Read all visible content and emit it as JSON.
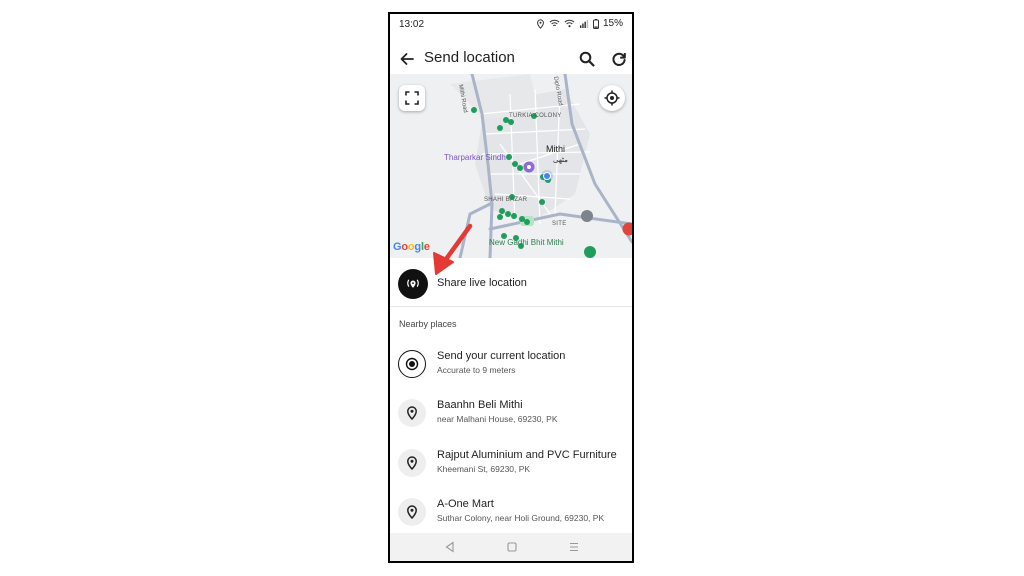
{
  "status_bar": {
    "time": "13:02",
    "battery": "15%",
    "icons": [
      "location-icon",
      "wifi-icon",
      "wifi-call-icon",
      "signal-icon",
      "battery-icon"
    ]
  },
  "app_bar": {
    "title": "Send location",
    "back_icon": "arrow-left-icon",
    "search_icon": "search-icon",
    "refresh_icon": "refresh-icon"
  },
  "map": {
    "labels": {
      "turkia": "TURKIA COLONY",
      "tharparkar": "Tharparkar Sindh",
      "mithi": "Mithi",
      "mithi_urdu": "مٹھی",
      "shahi_bazar": "SHAHI BAZAR",
      "site": "SITE",
      "gadhi": "New Gadhi Bhit Mithi",
      "road": "Mithi Road",
      "road2": "Diplo Road"
    },
    "logo": "Google",
    "buttons": [
      "fullscreen-icon",
      "my-location-icon"
    ]
  },
  "share_live": {
    "label": "Share live location",
    "icon": "live-location-icon"
  },
  "nearby": {
    "header": "Nearby places",
    "current": {
      "title": "Send your current location",
      "subtitle": "Accurate to 9 meters"
    },
    "places": [
      {
        "title": "Baanhn Beli Mithi",
        "subtitle": "near Malhani House, 69230, PK"
      },
      {
        "title": "Rajput Aluminium and PVC Furniture",
        "subtitle": "Kheemani St, 69230, PK"
      },
      {
        "title": "A-One Mart",
        "subtitle": "Suthar Colony, near Holi Ground, 69230, PK"
      }
    ]
  },
  "colors": {
    "accent_arrow": "#e53935",
    "map_pin_green": "#1e9e5a",
    "share_icon_bg": "#111111"
  }
}
